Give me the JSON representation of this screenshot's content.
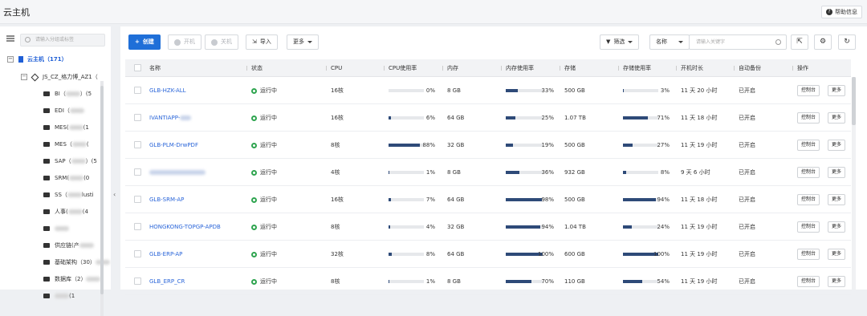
{
  "app": {
    "title": "云主机",
    "help_label": "帮助信息"
  },
  "sidebar": {
    "search_placeholder": "请输入分组或标签",
    "nodes": [
      {
        "label": "云主机（171）",
        "level": 0,
        "icon": "building-icon"
      },
      {
        "label": "JS_CZ_格力博_AZ1（",
        "level": 1,
        "icon": "region-icon"
      },
      {
        "label": "BI（",
        "suffix": "）(5",
        "level": 2,
        "icon": "folder-icon"
      },
      {
        "label": "EDI（",
        "suffix": "",
        "level": 2,
        "icon": "folder-icon"
      },
      {
        "label": "MES(",
        "suffix": "(1",
        "level": 2,
        "icon": "folder-icon"
      },
      {
        "label": "MES（",
        "suffix": "(",
        "level": 2,
        "icon": "folder-icon"
      },
      {
        "label": "SAP（",
        "suffix": "）(5",
        "level": 2,
        "icon": "folder-icon"
      },
      {
        "label": "SRM(",
        "suffix": "(0",
        "level": 2,
        "icon": "folder-icon"
      },
      {
        "label": "SS（",
        "suffix": "lusti",
        "level": 2,
        "icon": "folder-icon"
      },
      {
        "label": "人事(",
        "suffix": "(4",
        "level": 2,
        "icon": "folder-icon"
      },
      {
        "label": "",
        "suffix": "",
        "level": 2,
        "icon": "folder-icon"
      },
      {
        "label": "供应链(产",
        "suffix": "",
        "level": 2,
        "icon": "folder-icon"
      },
      {
        "label": "基础架构（30）",
        "suffix": "",
        "level": 2,
        "icon": "folder-icon"
      },
      {
        "label": "数据库（2）",
        "suffix": "",
        "level": 2,
        "icon": "folder-icon"
      },
      {
        "label": "",
        "suffix": "(1",
        "level": 2,
        "icon": "folder-icon"
      }
    ]
  },
  "toolbar": {
    "create": "创建",
    "start": "开机",
    "stop": "关机",
    "import": "导入",
    "more": "更多",
    "filter": "筛选",
    "field": "名称",
    "keyword_placeholder": "请输入关键字",
    "export_icon": "export-icon",
    "settings_icon": "gear-icon",
    "refresh_icon": "refresh-icon"
  },
  "table": {
    "columns": [
      "名称",
      "状态",
      "CPU",
      "CPU使用率",
      "内存",
      "内存使用率",
      "存储",
      "存储使用率",
      "开机时长",
      "自动备份",
      "操作"
    ],
    "console_label": "控制台",
    "more_label": "更多",
    "rows": [
      {
        "name": "GLB-HZK-ALL",
        "status": "运行中",
        "cpu": "16核",
        "cpu_pct": "0%",
        "cpu_val": 0,
        "mem": "8 GB",
        "mem_pct": "33%",
        "mem_val": 33,
        "disk": "500 GB",
        "disk_pct": "3%",
        "disk_val": 3,
        "uptime": "11 天 20 小时",
        "backup": "已开启"
      },
      {
        "name": "IVANTIAPP-",
        "status": "运行中",
        "cpu": "16核",
        "cpu_pct": "6%",
        "cpu_val": 6,
        "mem": "64 GB",
        "mem_pct": "25%",
        "mem_val": 25,
        "disk": "1.07 TB",
        "disk_pct": "71%",
        "disk_val": 71,
        "uptime": "11 天 18 小时",
        "backup": "已开启"
      },
      {
        "name": "GLB-PLM-DrwPDF",
        "status": "运行中",
        "cpu": "8核",
        "cpu_pct": "88%",
        "cpu_val": 88,
        "mem": "32 GB",
        "mem_pct": "19%",
        "mem_val": 19,
        "disk": "500 GB",
        "disk_pct": "27%",
        "disk_val": 27,
        "uptime": "11 天 19 小时",
        "backup": "已开启"
      },
      {
        "name": "",
        "status": "运行中",
        "cpu": "4核",
        "cpu_pct": "1%",
        "cpu_val": 1,
        "mem": "8 GB",
        "mem_pct": "36%",
        "mem_val": 36,
        "disk": "932 GB",
        "disk_pct": "8%",
        "disk_val": 8,
        "uptime": "9 天 6 小时",
        "backup": "已开启"
      },
      {
        "name": "GLB-SRM-AP",
        "status": "运行中",
        "cpu": "16核",
        "cpu_pct": "7%",
        "cpu_val": 7,
        "mem": "64 GB",
        "mem_pct": "98%",
        "mem_val": 98,
        "disk": "500 GB",
        "disk_pct": "94%",
        "disk_val": 94,
        "uptime": "11 天 18 小时",
        "backup": "已开启"
      },
      {
        "name": "HONGKONG-TOPGP-APDB",
        "status": "运行中",
        "cpu": "8核",
        "cpu_pct": "4%",
        "cpu_val": 4,
        "mem": "32 GB",
        "mem_pct": "94%",
        "mem_val": 94,
        "disk": "1.04 TB",
        "disk_pct": "24%",
        "disk_val": 24,
        "uptime": "11 天 19 小时",
        "backup": "已开启"
      },
      {
        "name": "GLB-ERP-AP",
        "status": "运行中",
        "cpu": "32核",
        "cpu_pct": "8%",
        "cpu_val": 8,
        "mem": "64 GB",
        "mem_pct": "100%",
        "mem_val": 100,
        "disk": "600 GB",
        "disk_pct": "100%",
        "disk_val": 100,
        "uptime": "11 天 19 小时",
        "backup": "已开启"
      },
      {
        "name": "GLB_ERP_CR",
        "status": "运行中",
        "cpu": "8核",
        "cpu_pct": "1%",
        "cpu_val": 1,
        "mem": "8 GB",
        "mem_pct": "70%",
        "mem_val": 70,
        "disk": "110 GB",
        "disk_pct": "54%",
        "disk_val": 54,
        "uptime": "11 天 19 小时",
        "backup": "已开启"
      }
    ]
  }
}
